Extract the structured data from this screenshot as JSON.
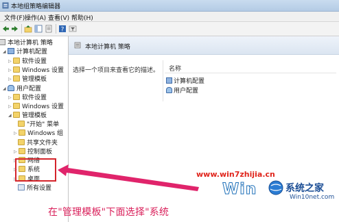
{
  "window": {
    "title": "本地组策略编辑器"
  },
  "menu": {
    "items": [
      "文件(F)",
      "操作(A)",
      "查看(V)",
      "帮助(H)"
    ]
  },
  "tree": {
    "root": "本地计算机 策略",
    "computer_config": "计算机配置",
    "cc_software": "软件设置",
    "cc_windows": "Windows 设置",
    "cc_admin": "管理模板",
    "user_config": "用户配置",
    "uc_software": "软件设置",
    "uc_windows": "Windows 设置",
    "uc_admin": "管理模板",
    "start_menu": "\"开始\" 菜单",
    "windows_comp": "Windows 组",
    "shared_folders": "共享文件夹",
    "control_panel": "控制面板",
    "network": "网络",
    "system": "系统",
    "desktop": "桌面",
    "all_settings": "所有设置"
  },
  "right": {
    "header": "本地计算机 策略",
    "description": "选择一个项目来查看它的描述。",
    "column_name": "名称",
    "items": [
      "计算机配置",
      "用户配置"
    ]
  },
  "overlay": {
    "url": "www.win7zhijia.cn",
    "caption": "在\"管理模板\"下面选择\"系统",
    "watermark_win": "Win",
    "watermark_cn": "系统之家",
    "watermark_domain": "Win10net.com"
  },
  "colors": {
    "highlight": "#d4232a",
    "caption": "#d91f5a",
    "url": "#e0241b"
  }
}
